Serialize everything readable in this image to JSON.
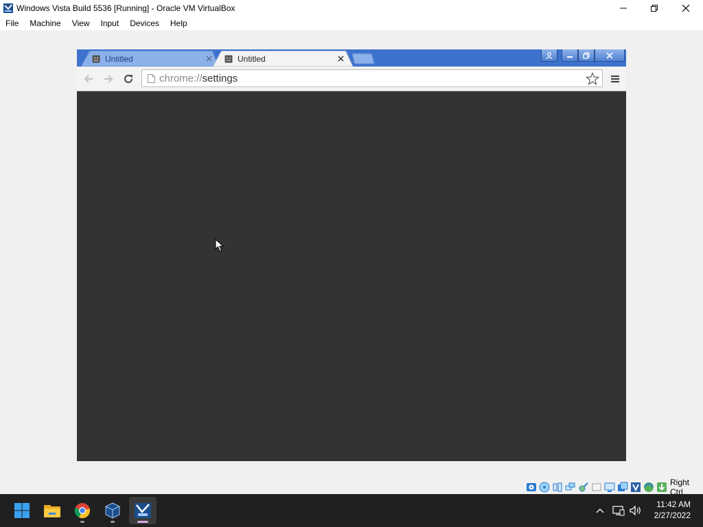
{
  "window": {
    "title": "Windows Vista Build 5536 [Running] - Oracle VM VirtualBox",
    "controls": [
      "minimize-icon",
      "restore-icon",
      "close-icon"
    ]
  },
  "menubar": {
    "items": [
      "File",
      "Machine",
      "View",
      "Input",
      "Devices",
      "Help"
    ]
  },
  "guest_browser": {
    "tabs": [
      {
        "title": "Untitled",
        "active": false
      },
      {
        "title": "Untitled",
        "active": true
      }
    ],
    "omnibox": {
      "scheme": "chrome://",
      "path": "settings"
    },
    "theme_color": "#3d73cf",
    "content_background": "#333333"
  },
  "statusbar": {
    "icons": [
      "hard-disk-icon",
      "optical-drive-icon",
      "audio-icon",
      "network-icon",
      "usb-icon",
      "shared-folders-icon",
      "display-icon",
      "video-capture-icon",
      "virtualization-icon",
      "mouse-integration-icon",
      "keyboard-capture-icon"
    ],
    "host_key": "Right Ctrl"
  },
  "taskbar": {
    "apps": [
      "windows-start-icon",
      "file-explorer-icon",
      "chrome-icon",
      "virtualbox-icon",
      "vista-vm-icon"
    ],
    "tray_icons": [
      "chevron-up-icon",
      "network-icon",
      "volume-icon"
    ],
    "time": "11:42 AM",
    "date": "2/27/2022"
  }
}
